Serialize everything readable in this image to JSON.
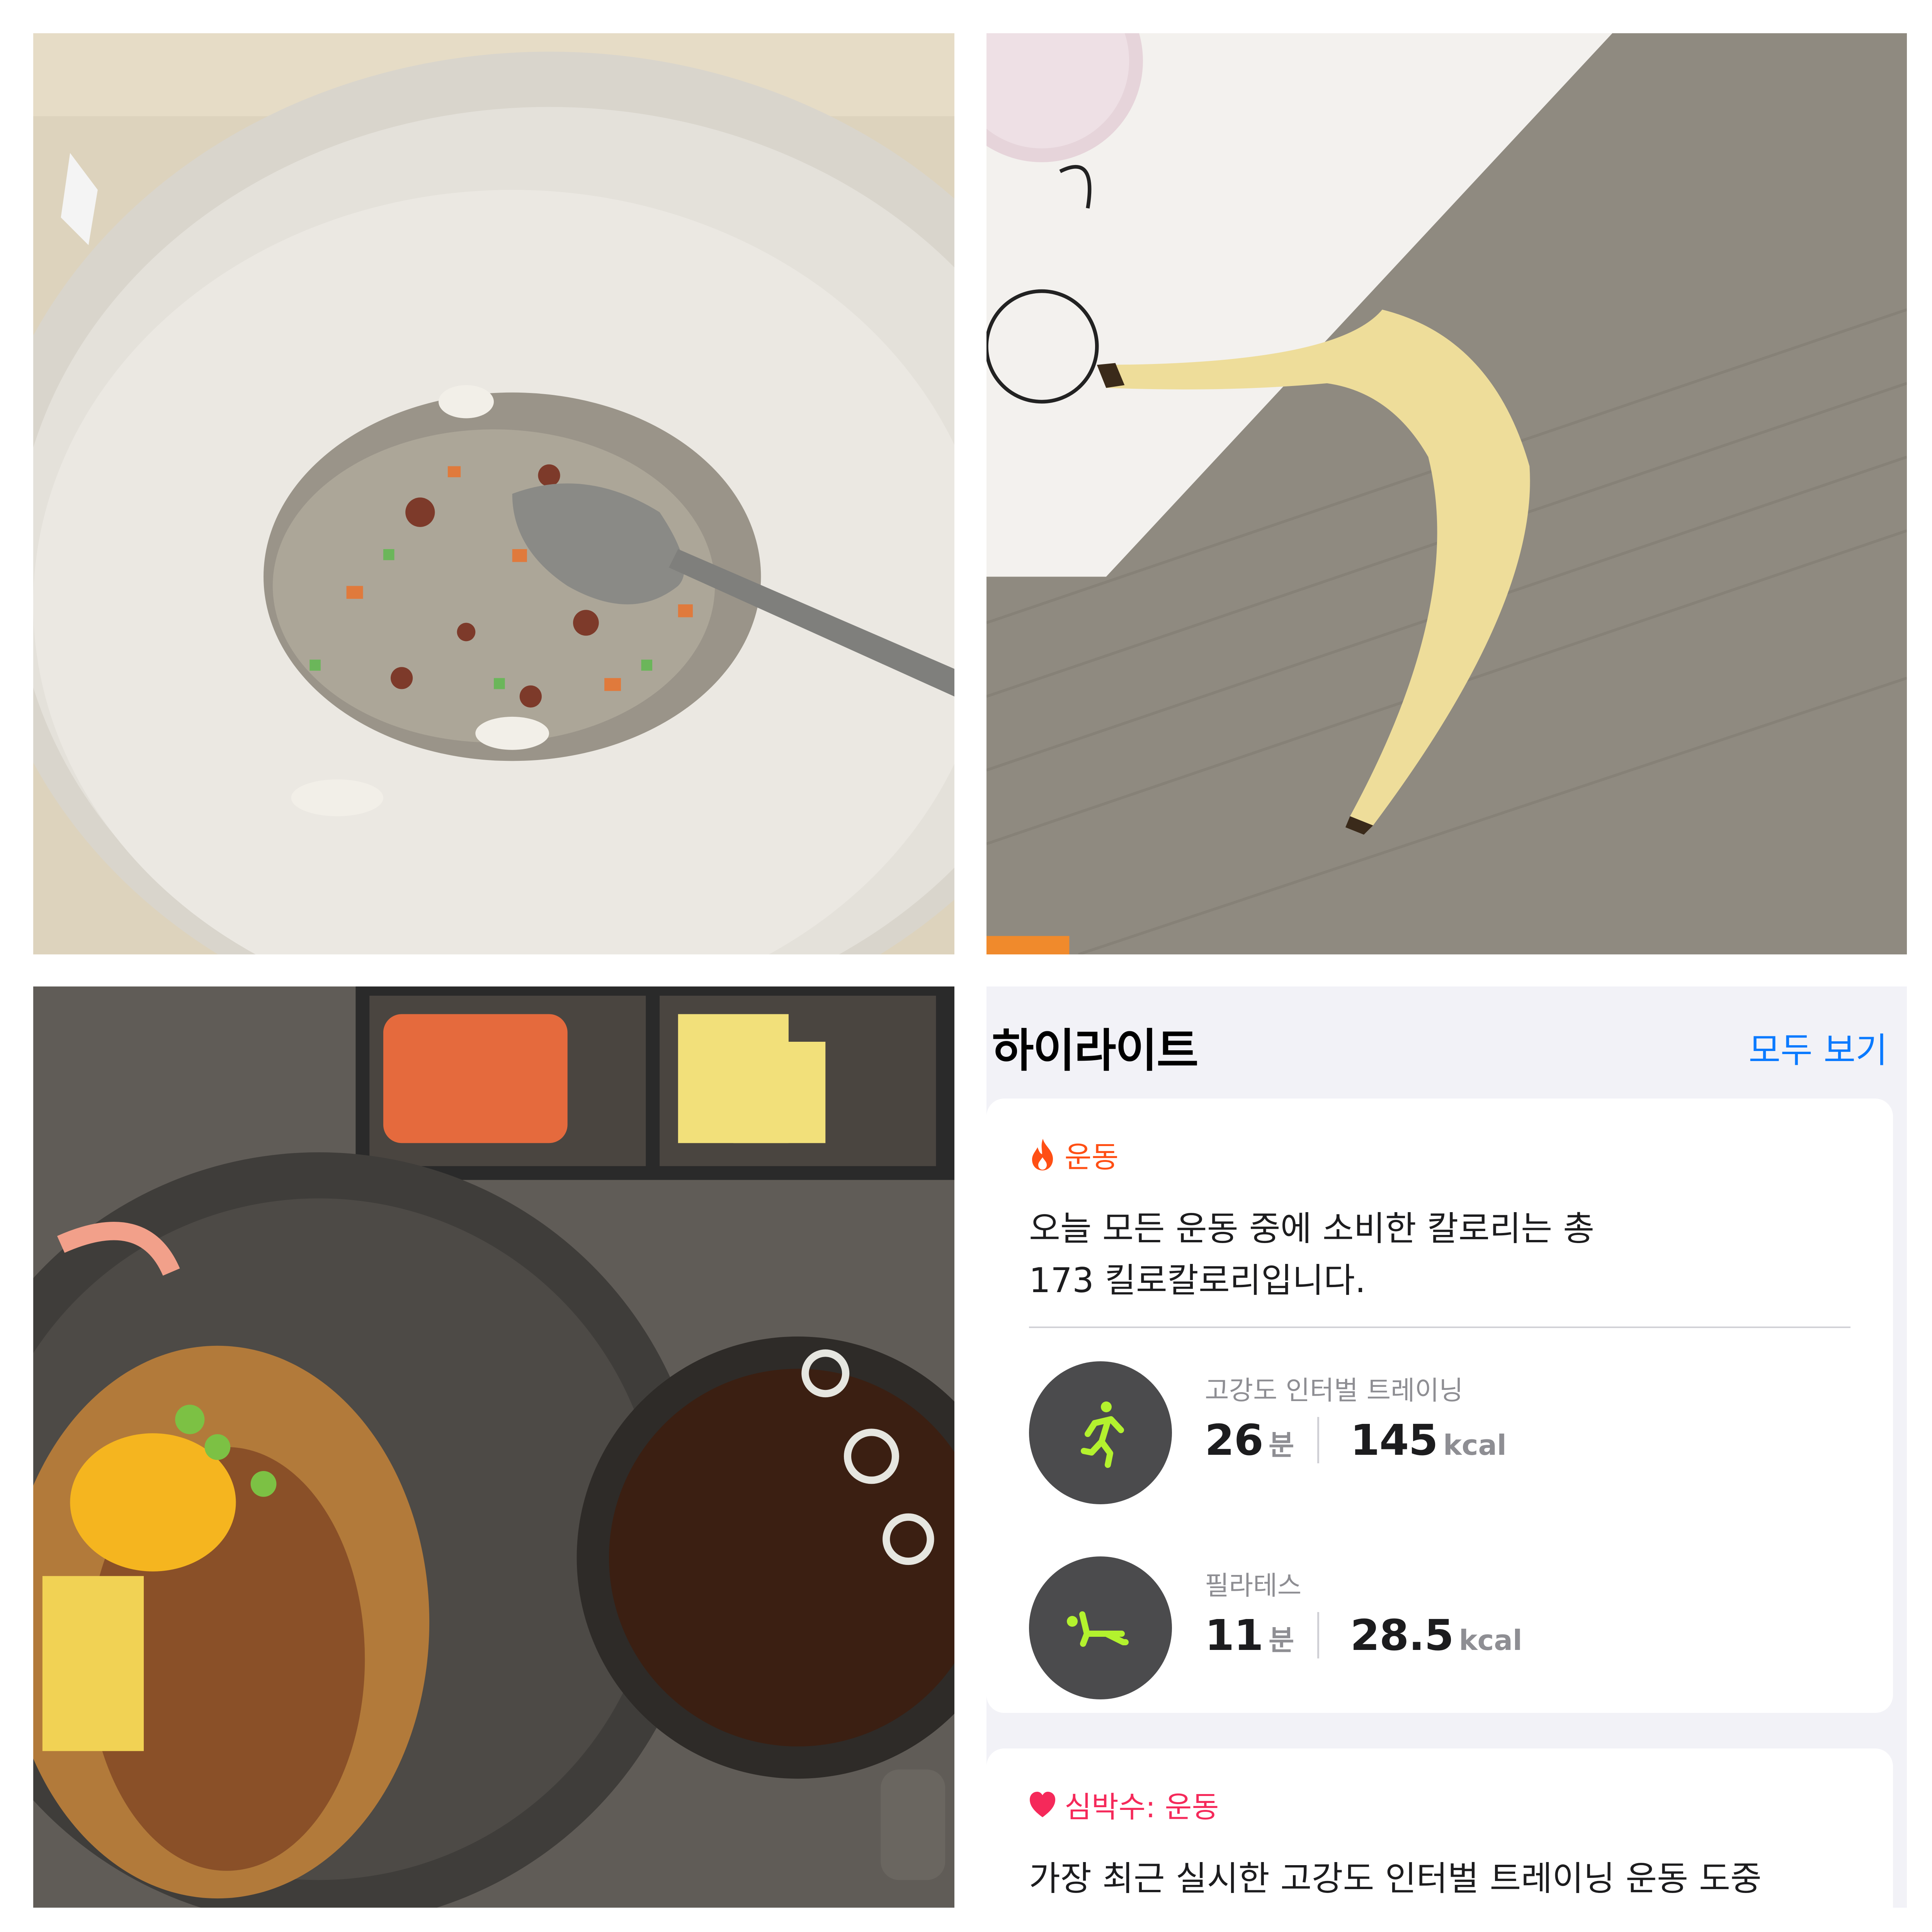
{
  "highlights": {
    "title": "하이라이트",
    "show_all_label": "모두 보기",
    "accent_color": "#0a7aff",
    "workout_card": {
      "category_label": "운동",
      "category_color": "#ff4f14",
      "category_icon": "flame-icon",
      "summary_line1": "오늘 모든 운동 중에 소비한 칼로리는 총",
      "summary_line2": "173 킬로칼로리입니다.",
      "activities": [
        {
          "name": "고강도 인터벌 트레이닝",
          "icon": "running-figure-icon",
          "duration_value": "26",
          "duration_unit": "분",
          "energy_value": "145",
          "energy_unit": "kcal"
        },
        {
          "name": "필라테스",
          "icon": "pilates-figure-icon",
          "duration_value": "11",
          "duration_unit": "분",
          "energy_value": "28.5",
          "energy_unit": "kcal"
        }
      ],
      "icon_color": "#b3f22e"
    },
    "heart_card": {
      "category_label": "심박수: 운동",
      "category_color": "#f5295a",
      "category_icon": "heart-icon",
      "summary_line1": "가장 최근 실시한 고강도 인터벌 트레이닝 운동 도중"
    }
  }
}
